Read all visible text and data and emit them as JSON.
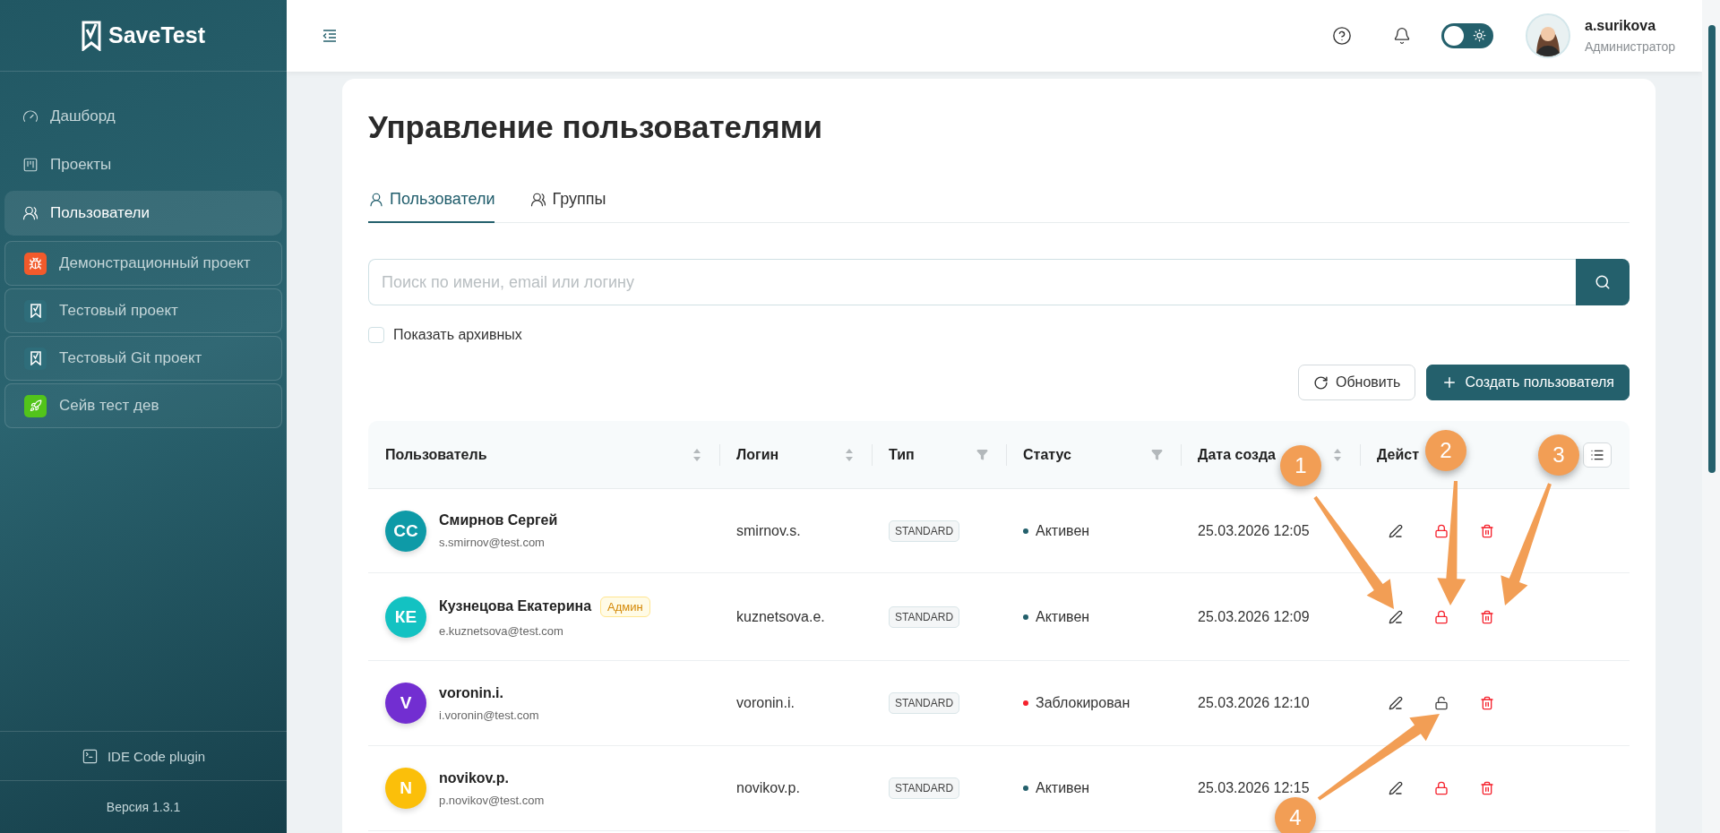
{
  "brand": {
    "name": "SaveTest"
  },
  "sidebar": {
    "items": [
      {
        "kind": "gauge",
        "label": "Дашборд",
        "selected": false
      },
      {
        "kind": "board",
        "label": "Проекты",
        "selected": false
      },
      {
        "kind": "users",
        "label": "Пользователи",
        "selected": true
      }
    ],
    "projects": [
      {
        "kind": "bug",
        "label": "Демонстрационный проект",
        "color": "#f25a2b"
      },
      {
        "kind": "doc",
        "label": "Тестовый проект",
        "color": "#2e6d7a"
      },
      {
        "kind": "doc",
        "label": "Тестовый Git проект",
        "color": "#2e6d7a"
      },
      {
        "kind": "rocket",
        "label": "Сейв тест дев",
        "color": "#52c41a"
      }
    ],
    "plugin": "IDE Code plugin",
    "version": "Версия 1.3.1"
  },
  "header": {
    "dark_mode": false,
    "user": {
      "name": "a.surikova",
      "role": "Администратор"
    }
  },
  "page": {
    "title": "Управление пользователями",
    "tabs": [
      {
        "kind": "user",
        "label": "Пользователи",
        "selected": true
      },
      {
        "kind": "group",
        "label": "Группы",
        "selected": false
      }
    ],
    "search": {
      "placeholder": "Поиск по имени, email или логину"
    },
    "show_archived": {
      "label": "Показать архивных",
      "checked": false
    },
    "buttons": [
      {
        "kind": "refresh",
        "label": "Обновить"
      },
      {
        "kind": "create",
        "label": "Создать пользователя"
      }
    ]
  },
  "table": {
    "columns": [
      {
        "label": "Пользователь",
        "kind": "sort"
      },
      {
        "label": "Логин",
        "kind": "sort"
      },
      {
        "label": "Тип",
        "kind": "filter"
      },
      {
        "label": "Статус",
        "kind": "filter"
      },
      {
        "label": "Дата созда",
        "kind": "sort"
      },
      {
        "label": "Дейст",
        "kind": "none"
      }
    ],
    "rows": [
      {
        "avatar": {
          "initials": "СС",
          "color": "#0e9aa7"
        },
        "name": "Смирнов Сергей",
        "email": "s.smirnov@test.com",
        "login": "smirnov.s.",
        "type": "STANDARD",
        "status": {
          "label": "Активен",
          "color": "#24606c"
        },
        "created": "25.03.2026 12:05",
        "blocked": false
      },
      {
        "avatar": {
          "initials": "КЕ",
          "color": "#13c2c2"
        },
        "name": "Кузнецова Екатерина",
        "badge": "Админ",
        "email": "e.kuznetsova@test.com",
        "login": "kuznetsova.e.",
        "type": "STANDARD",
        "status": {
          "label": "Активен",
          "color": "#24606c"
        },
        "created": "25.03.2026 12:09",
        "blocked": false
      },
      {
        "avatar": {
          "initials": "V",
          "color": "#722ed1"
        },
        "name": "voronin.i.",
        "email": "i.voronin@test.com",
        "login": "voronin.i.",
        "type": "STANDARD",
        "status": {
          "label": "Заблокирован",
          "color": "#f5222d"
        },
        "created": "25.03.2026 12:10",
        "blocked": true
      },
      {
        "avatar": {
          "initials": "N",
          "color": "#fbbf0a"
        },
        "name": "novikov.p.",
        "email": "p.novikov@test.com",
        "login": "novikov.p.",
        "type": "STANDARD",
        "status": {
          "label": "Активен",
          "color": "#24606c"
        },
        "created": "25.03.2026 12:15",
        "blocked": false
      }
    ]
  },
  "annotations": [
    {
      "number": "1"
    },
    {
      "number": "2"
    },
    {
      "number": "3"
    },
    {
      "number": "4"
    }
  ]
}
